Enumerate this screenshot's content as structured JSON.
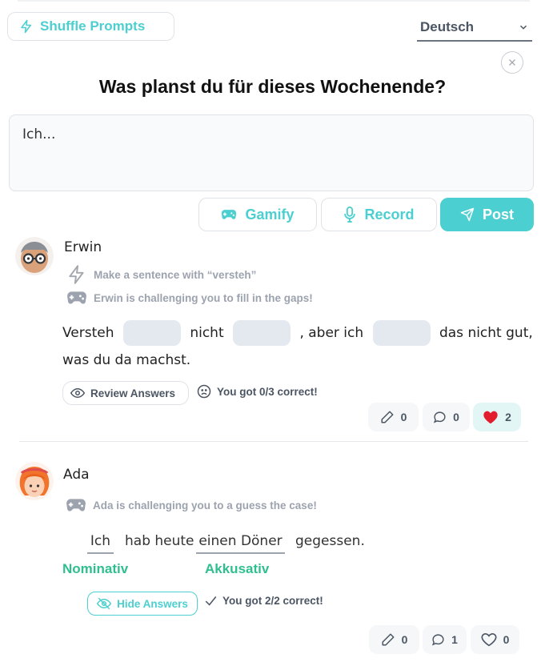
{
  "toolbar": {
    "shuffle_label": "Shuffle Prompts",
    "language": "Deutsch"
  },
  "prompt": {
    "title": "Was planst du für dieses Wochenende?",
    "input_value": "Ich..."
  },
  "actions": {
    "gamify_label": "Gamify",
    "record_label": "Record",
    "post_label": "Post"
  },
  "posts": [
    {
      "user": "Erwin",
      "prompt_line": "Make a sentence with “versteh”",
      "challenge_line": "Erwin is challenging you to fill in the gaps!",
      "sentence_parts": [
        "Versteh",
        "nicht",
        ", aber ich",
        "das nicht gut,",
        "was du da machst."
      ],
      "review_label": "Review Answers",
      "result": "You got 0/3 correct!",
      "counts": {
        "edits": "0",
        "comments": "0",
        "likes": "2"
      }
    },
    {
      "user": "Ada",
      "challenge_line": "Ada is challenging you to a guess the case!",
      "words": [
        "Ich",
        "hab heute",
        "einen Döner",
        "gegessen."
      ],
      "cases": [
        "Nominativ",
        "Akkusativ"
      ],
      "hide_label": "Hide Answers",
      "result": "You got 2/2 correct!",
      "counts": {
        "edits": "0",
        "comments": "1",
        "likes": "0"
      }
    }
  ],
  "colors": {
    "accent": "#4ccfd0",
    "case_green": "#2fbf8f",
    "heart_red": "#e11d2e"
  }
}
